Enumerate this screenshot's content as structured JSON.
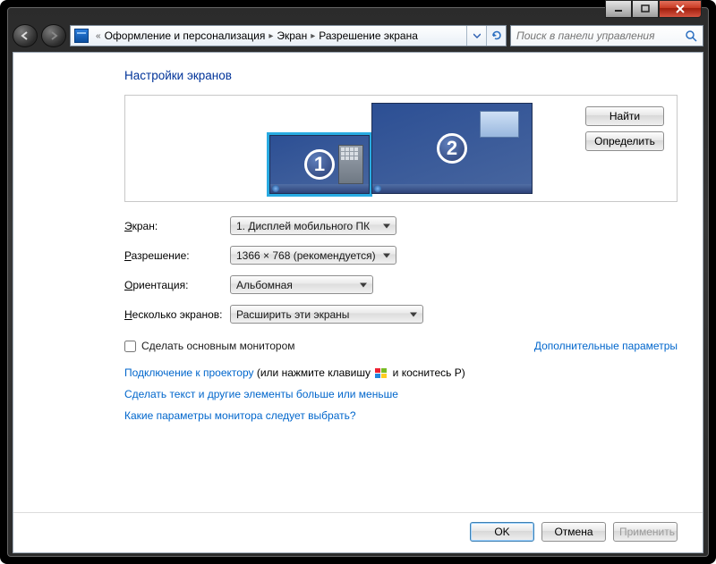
{
  "breadcrumb": {
    "root_full": "Оформление и персонализация",
    "level1": "Экран",
    "level2": "Разрешение экрана"
  },
  "search": {
    "placeholder": "Поиск в панели управления"
  },
  "page": {
    "title": "Настройки экранов"
  },
  "preview": {
    "find_btn": "Найти",
    "detect_btn": "Определить",
    "monitor1_number": "1",
    "monitor2_number": "2"
  },
  "form": {
    "screen_label_pre": "Э",
    "screen_label_post": "кран:",
    "screen_value": "1. Дисплей мобильного ПК",
    "res_label_pre": "Р",
    "res_label_post": "азрешение:",
    "res_value": "1366 × 768 (рекомендуется)",
    "orient_label_pre": "О",
    "orient_label_post": "риентация:",
    "orient_value": "Альбомная",
    "multi_label_pre": "Н",
    "multi_label_post": "есколько экранов:",
    "multi_value": "Расширить эти экраны"
  },
  "checkbox": {
    "label": "Сделать основным монитором"
  },
  "links": {
    "advanced": "Дополнительные параметры",
    "projector": "Подключение к проектору",
    "projector_suffix_pre": " (или нажмите клавишу ",
    "projector_suffix_post": " и коснитесь P)",
    "textsize": "Сделать текст и другие элементы больше или меньше",
    "which": "Какие параметры монитора следует выбрать?"
  },
  "buttons": {
    "ok": "OK",
    "cancel": "Отмена",
    "apply": "Применить"
  }
}
